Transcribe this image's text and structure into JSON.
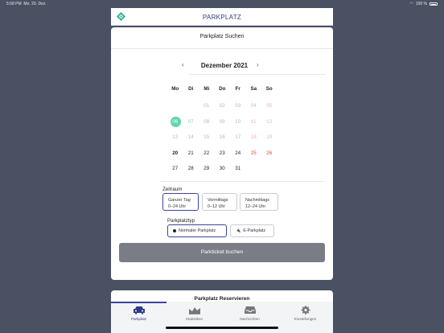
{
  "status": {
    "time": "5:58 PM",
    "date": "Mo. 20. Dez.",
    "battery": "100 %"
  },
  "header": {
    "title": "PARKPLATZ"
  },
  "card": {
    "title": "Parkplatz Suchen",
    "month_label": "Dezember 2021",
    "prev": "‹",
    "next": "›",
    "weekdays": [
      "Mo",
      "Di",
      "Mi",
      "Do",
      "Fr",
      "Sa",
      "So"
    ],
    "weeks": [
      [
        "",
        "",
        "01",
        "02",
        "03",
        "04",
        "05"
      ],
      [
        "06",
        "07",
        "08",
        "09",
        "10",
        "11",
        "12"
      ],
      [
        "13",
        "14",
        "15",
        "16",
        "17",
        "18",
        "19"
      ],
      [
        "20",
        "21",
        "22",
        "23",
        "24",
        "25",
        "26"
      ],
      [
        "27",
        "28",
        "29",
        "30",
        "31",
        "",
        ""
      ]
    ],
    "zeitraum_label": "Zeitraum",
    "zeitraum_options": [
      {
        "title": "Ganzer Tag",
        "sub": "0–24 Uhr"
      },
      {
        "title": "Vormittags",
        "sub": "0–12 Uhr"
      },
      {
        "title": "Nachmittags",
        "sub": "12–24 Uhr"
      }
    ],
    "typ_label": "Parkplatztyp",
    "typ_options": [
      "Normaler Parkplatz",
      "E-Parkplatz"
    ],
    "book_button": "Parkticket buchen"
  },
  "card2": {
    "title": "Parkplatz Reservieren"
  },
  "tabs": [
    "Parkplatz",
    "Statistiken",
    "Nachrichten",
    "Einstellungen"
  ]
}
